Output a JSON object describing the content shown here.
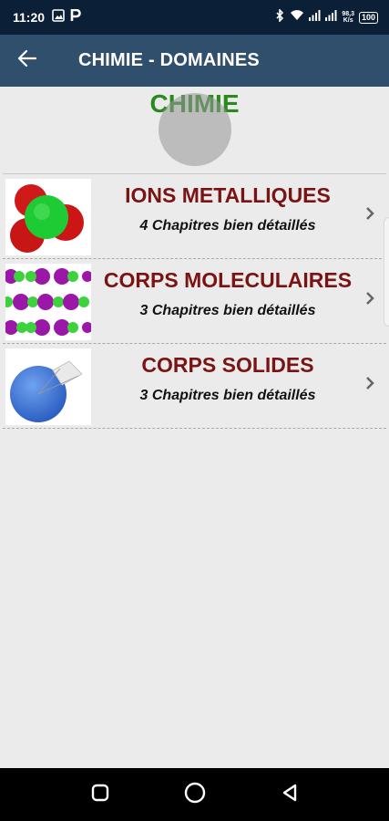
{
  "status_bar": {
    "time": "11:20",
    "speed_value": "98,3",
    "speed_unit": "K/s",
    "battery": "100",
    "icons": [
      "image-icon",
      "parking-icon",
      "bluetooth-icon",
      "wifi-icon",
      "signal-icon",
      "signal-icon",
      "battery-icon"
    ]
  },
  "app_bar": {
    "title": "CHIMIE - DOMAINES",
    "back_icon": "arrow-left-icon"
  },
  "section": {
    "title": "CHIMIE",
    "title_color": "#2a8a1e"
  },
  "items": [
    {
      "title": "IONS METALLIQUES",
      "subtitle": "4 Chapitres bien détaillés",
      "thumbnail": "ion-molecule-image"
    },
    {
      "title": "CORPS MOLECULAIRES",
      "subtitle": "3 Chapitres bien détaillés",
      "thumbnail": "molecular-lattice-image"
    },
    {
      "title": "CORPS SOLIDES",
      "subtitle": "3 Chapitres bien détaillés",
      "thumbnail": "solid-sphere-image"
    }
  ],
  "colors": {
    "status_bar": "#0b1f37",
    "app_bar": "#2f4f6d",
    "item_title": "#7a1414",
    "background": "#ebebeb"
  },
  "nav_bar": {
    "icons": [
      "recents-icon",
      "home-icon",
      "back-triangle-icon"
    ]
  }
}
